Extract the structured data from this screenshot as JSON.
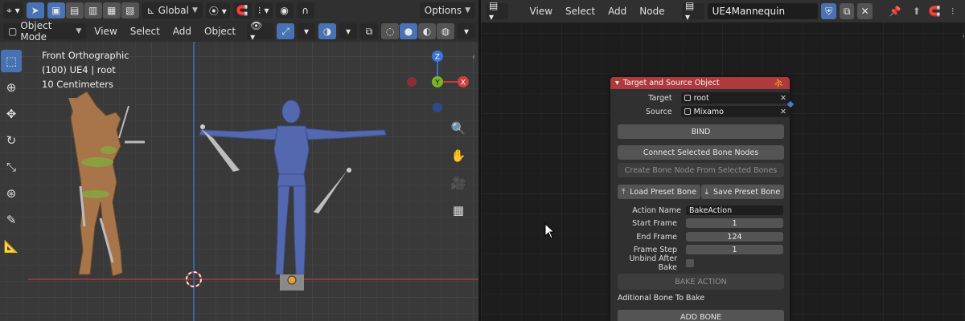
{
  "viewport": {
    "header": {
      "transform_orientation": "Global",
      "options_label": "Options",
      "mode": "Object Mode",
      "menus": [
        "View",
        "Select",
        "Add",
        "Object"
      ]
    },
    "overlay": {
      "view_name": "Front Orthographic",
      "collection": "(100) UE4 | root",
      "scale": "10 Centimeters"
    },
    "gizmo": {
      "z": "Z",
      "y": "Y",
      "x": "X"
    },
    "tools": [
      "select-box-icon",
      "cursor-icon",
      "move-icon",
      "rotate-icon",
      "scale-icon",
      "transform-icon",
      "annotate-icon",
      "measure-icon"
    ],
    "colors": {
      "accent": "#4772b3",
      "mannequin": "#5468b0",
      "mixamo_skin": "#b07a4e",
      "axis_x": "#c83c3c",
      "axis_z": "#3c6ec8"
    }
  },
  "node_editor": {
    "header": {
      "menus": [
        "View",
        "Select",
        "Add",
        "Node"
      ],
      "tree_name": "UE4Mannequin"
    },
    "node": {
      "title": "Target and Source Object",
      "target_label": "Target",
      "target_value": "root",
      "source_label": "Source",
      "source_value": "Mixamo",
      "bind_label": "BIND",
      "connect_label": "Connect Selected Bone Nodes",
      "create_label": "Create Bone Node From Selected Bones",
      "load_preset_label": "Load Preset Bone",
      "save_preset_label": "Save Preset Bone",
      "action_name_label": "Action Name",
      "action_name_value": "BakeAction",
      "start_frame_label": "Start Frame",
      "start_frame_value": "1",
      "end_frame_label": "End Frame",
      "end_frame_value": "124",
      "frame_step_label": "Frame Step",
      "frame_step_value": "1",
      "unbind_label": "Unbind After Bake",
      "bake_label": "BAKE ACTION",
      "additional_label": "Aditional Bone To Bake",
      "add_bone_label": "ADD BONE"
    },
    "colors": {
      "node_header": "#b0393e",
      "socket": "#4a7ccc"
    }
  }
}
